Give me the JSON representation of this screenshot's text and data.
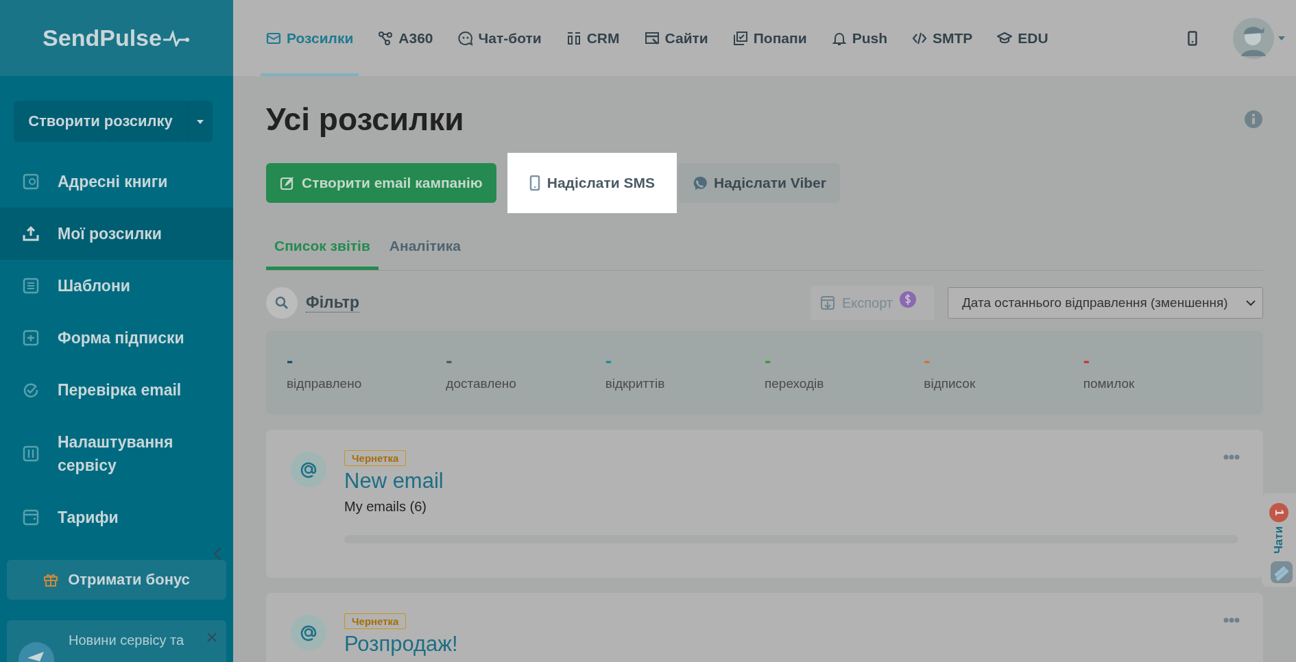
{
  "logo": {
    "text": "SendPulse"
  },
  "nav": [
    {
      "label": "Розсилки",
      "selected": true
    },
    {
      "label": "A360",
      "selected": false
    },
    {
      "label": "Чат-боти",
      "selected": false
    },
    {
      "label": "CRM",
      "selected": false
    },
    {
      "label": "Сайти",
      "selected": false
    },
    {
      "label": "Попапи",
      "selected": false
    },
    {
      "label": "Push",
      "selected": false
    },
    {
      "label": "SMTP",
      "selected": false
    },
    {
      "label": "EDU",
      "selected": false
    }
  ],
  "sidebar": {
    "create_button": "Створити розсилку",
    "items": [
      {
        "label": "Адресні книги",
        "selected": false
      },
      {
        "label": "Мої розсилки",
        "selected": true
      },
      {
        "label": "Шаблони",
        "selected": false
      },
      {
        "label": "Форма підписки",
        "selected": false
      },
      {
        "label": "Перевірка email",
        "selected": false
      },
      {
        "label": "Налаштування сервісу",
        "selected": false
      },
      {
        "label": "Тарифи",
        "selected": false
      }
    ],
    "bonus_button": "Отримати бонус",
    "news": "Новини сервісу та"
  },
  "page_title": "Усі розсилки",
  "actions": [
    {
      "label": "Створити email кампанію",
      "kind": "email",
      "highlighted": false
    },
    {
      "label": "Надіслати SMS",
      "kind": "sms",
      "highlighted": true
    },
    {
      "label": "Надіслати Viber",
      "kind": "viber",
      "highlighted": false
    }
  ],
  "tabs": [
    {
      "label": "Список звітів",
      "selected": true
    },
    {
      "label": "Аналітика",
      "selected": false
    }
  ],
  "filter": "Фільтр",
  "export": "Експорт",
  "sort": {
    "value": "Дата останнього відправлення (зменшення)"
  },
  "stats": [
    {
      "value": "-",
      "label": "відправлено",
      "color": "#1f4f6a"
    },
    {
      "value": "-",
      "label": "доставлено",
      "color": "#4a5a60"
    },
    {
      "value": "-",
      "label": "відкриттів",
      "color": "#1f8aa0"
    },
    {
      "value": "-",
      "label": "переходів",
      "color": "#3a9a3a"
    },
    {
      "value": "-",
      "label": "відписок",
      "color": "#d0703a"
    },
    {
      "value": "-",
      "label": "помилок",
      "color": "#c83a3a"
    }
  ],
  "campaigns": [
    {
      "status": "Чернетка",
      "title": "New email",
      "subtitle": "My emails (6)"
    },
    {
      "status": "Чернетка",
      "title": "Розпродаж!"
    }
  ],
  "chat": {
    "label": "Чати",
    "badge": "1"
  }
}
